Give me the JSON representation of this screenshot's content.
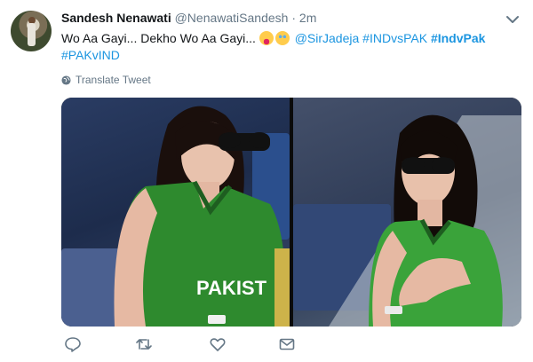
{
  "tweet": {
    "display_name": "Sandesh Nenawati",
    "handle": "@NenawatiSandesh",
    "separator": "·",
    "time": "2m",
    "text_main": "Wo Aa Gayi... Dekho Wo Aa Gayi...",
    "mention": "@SirJadeja",
    "hashtag1": "#INDvsPAK",
    "hashtag2": "#IndvPak",
    "hashtag3": "#PAKvIND",
    "translate_label": "Translate Tweet",
    "jersey_text": "PAKIST"
  },
  "colors": {
    "link": "#1b95e0",
    "secondary_text": "#657786",
    "jersey_green": "#2e8a2e"
  },
  "icons": [
    "chevron-down-icon",
    "laughing-tongue-emoji",
    "tears-of-joy-emoji",
    "globe-icon",
    "reply-icon",
    "retweet-icon",
    "like-icon",
    "direct-message-icon"
  ]
}
